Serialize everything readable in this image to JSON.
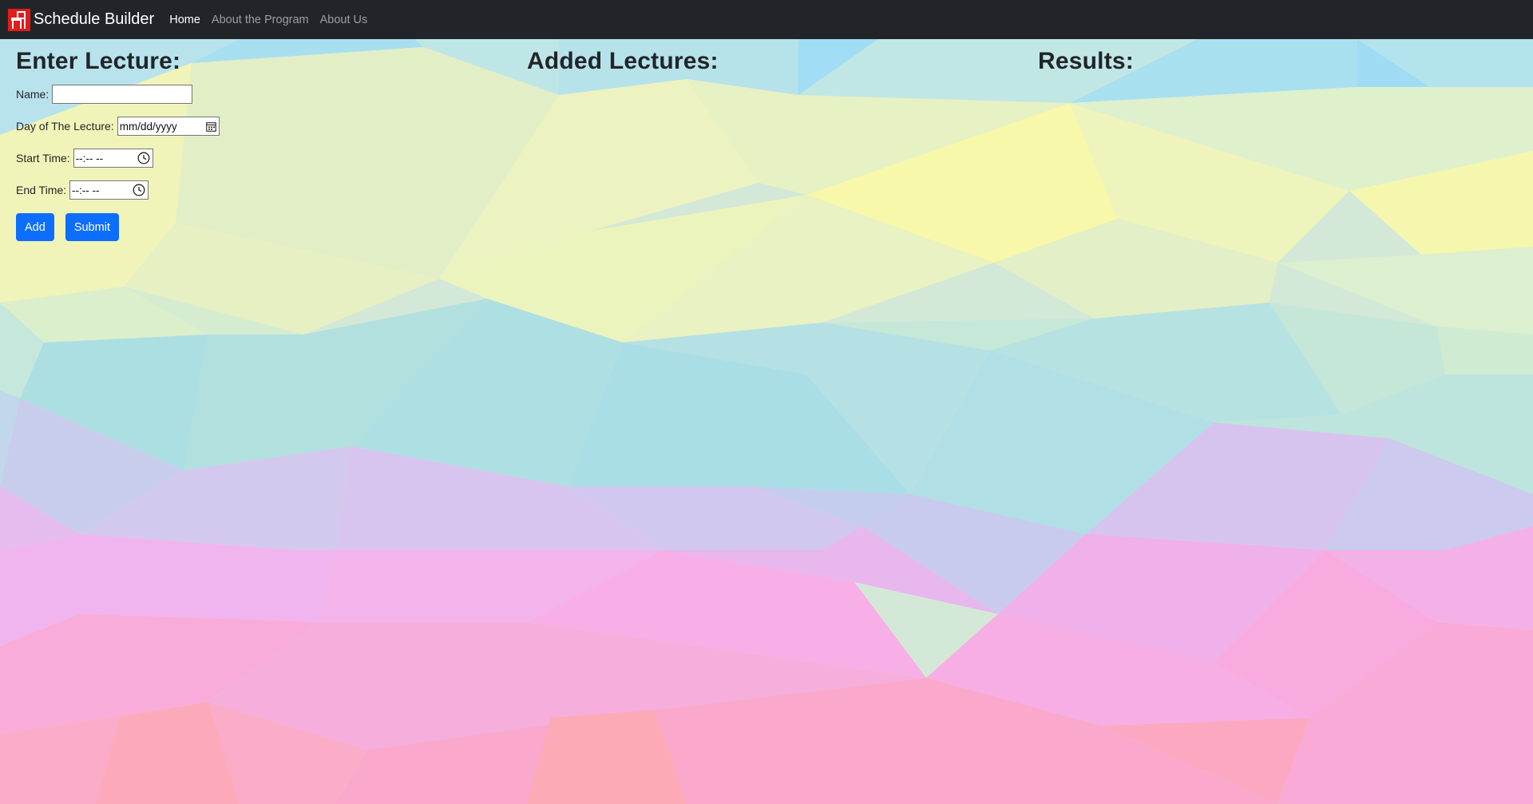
{
  "navbar": {
    "brand": "Schedule Builder",
    "brand_logo_icon": "chair-logo-icon",
    "links": [
      {
        "label": "Home",
        "active": true
      },
      {
        "label": "About the Program",
        "active": false
      },
      {
        "label": "About Us",
        "active": false
      }
    ],
    "background": "#212529"
  },
  "enter_lecture": {
    "heading": "Enter Lecture:",
    "name_label": "Name:",
    "name_value": "",
    "day_label": "Day of The Lecture:",
    "day_placeholder": "mm/dd/yyyy",
    "start_label": "Start Time:",
    "start_placeholder": "--:-- --",
    "end_label": "End Time:",
    "end_placeholder": "--:-- --",
    "add_button": "Add",
    "submit_button": "Submit",
    "button_color": "#0d6efd"
  },
  "added_lectures": {
    "heading": "Added Lectures:"
  },
  "results": {
    "heading": "Results:"
  }
}
